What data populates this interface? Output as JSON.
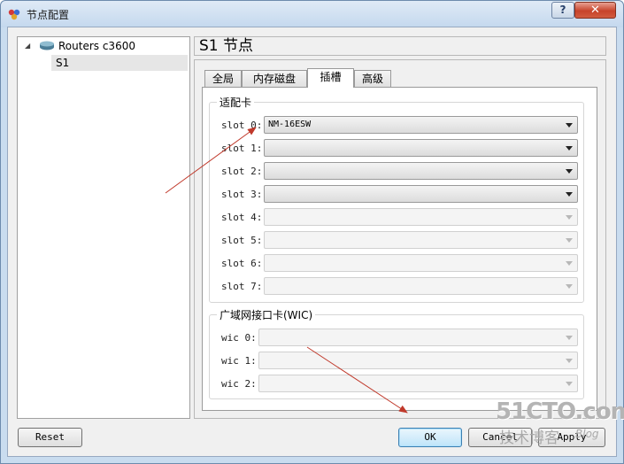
{
  "window": {
    "title": "节点配置",
    "help_label": "?",
    "close_label": "✕"
  },
  "tree": {
    "root_label": "Routers c3600",
    "child_label": "S1"
  },
  "header": {
    "title": "S1 节点"
  },
  "tabs": [
    {
      "label": "全局",
      "active": false
    },
    {
      "label": "内存磁盘",
      "active": false
    },
    {
      "label": "插槽",
      "active": true
    },
    {
      "label": "高级",
      "active": false
    }
  ],
  "adapters": {
    "title": "适配卡",
    "slots": [
      {
        "label": "slot 0:",
        "value": "NM-16ESW",
        "enabled": true
      },
      {
        "label": "slot 1:",
        "value": "",
        "enabled": true
      },
      {
        "label": "slot 2:",
        "value": "",
        "enabled": true
      },
      {
        "label": "slot 3:",
        "value": "",
        "enabled": true
      },
      {
        "label": "slot 4:",
        "value": "",
        "enabled": false
      },
      {
        "label": "slot 5:",
        "value": "",
        "enabled": false
      },
      {
        "label": "slot 6:",
        "value": "",
        "enabled": false
      },
      {
        "label": "slot 7:",
        "value": "",
        "enabled": false
      }
    ]
  },
  "wics": {
    "title": "广域网接口卡(WIC)",
    "slots": [
      {
        "label": "wic 0:",
        "value": "",
        "enabled": false
      },
      {
        "label": "wic 1:",
        "value": "",
        "enabled": false
      },
      {
        "label": "wic 2:",
        "value": "",
        "enabled": false
      }
    ]
  },
  "buttons": {
    "reset": "Reset",
    "ok": "OK",
    "cancel": "Cancel",
    "apply": "Apply"
  },
  "watermark": {
    "main": "51CTO.com",
    "sub": "技术博客",
    "blog": "Blog"
  },
  "colors": {
    "annotation_arrow": "#c0392b",
    "close_button": "#c7432a",
    "default_button_border": "#3c7fb1"
  }
}
